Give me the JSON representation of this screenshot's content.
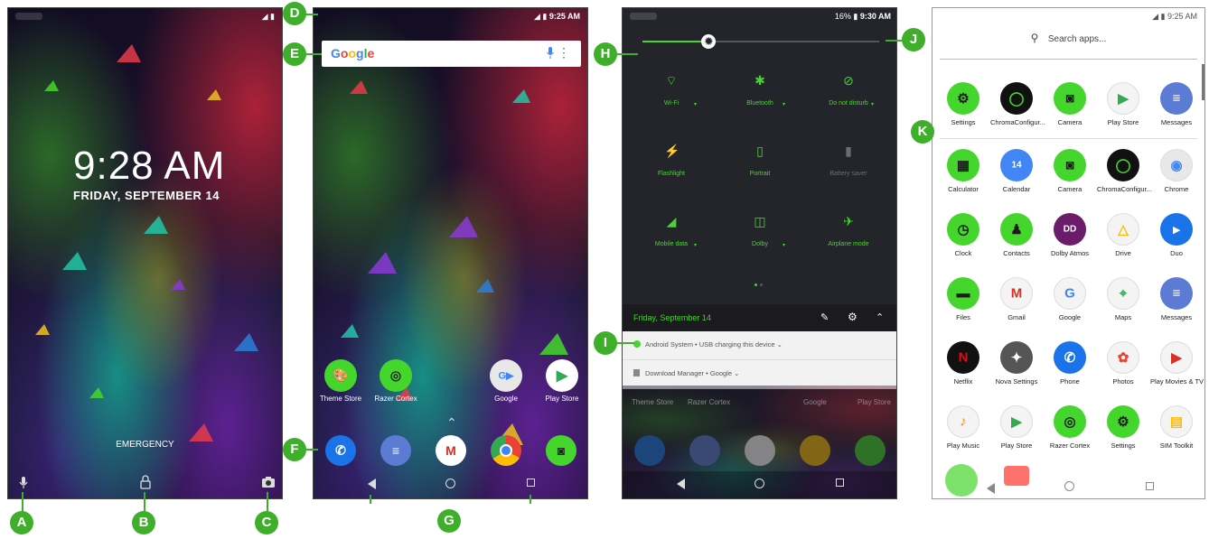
{
  "lock_screen": {
    "time": "9:28 AM",
    "date": "FRIDAY, SEPTEMBER 14",
    "emergency": "EMERGENCY"
  },
  "home_screen": {
    "status_time": "9:25 AM",
    "search_logo": "Google",
    "apps": [
      {
        "label": "Theme Store",
        "color": "#44d62c"
      },
      {
        "label": "Razer Cortex",
        "color": "#44d62c"
      },
      {
        "label": "Google",
        "color": "#e8e8e8"
      },
      {
        "label": "Play Store",
        "color": "#ffffff"
      }
    ],
    "dock": [
      {
        "name": "phone",
        "color": "#1a73e8"
      },
      {
        "name": "messages",
        "color": "#5b7bd5"
      },
      {
        "name": "gmail",
        "color": "#ffffff"
      },
      {
        "name": "chrome",
        "color": "#e8e8e8"
      },
      {
        "name": "camera",
        "color": "#44d62c"
      }
    ]
  },
  "quick_settings": {
    "status_battery": "16%",
    "status_time": "9:30 AM",
    "brightness_level": 0.28,
    "tiles": [
      {
        "label": "Wi-Fi",
        "on": true,
        "dropdown": true
      },
      {
        "label": "Bluetooth",
        "on": true,
        "dropdown": true
      },
      {
        "label": "Do not disturb",
        "on": true,
        "dropdown": true
      },
      {
        "label": "Flashlight",
        "on": true,
        "dropdown": false
      },
      {
        "label": "Portrait",
        "on": true,
        "dropdown": false
      },
      {
        "label": "Battery saver",
        "on": false,
        "dropdown": false
      },
      {
        "label": "Mobile data",
        "on": true,
        "dropdown": true
      },
      {
        "label": "Dolby",
        "on": true,
        "dropdown": true
      },
      {
        "label": "Airplane mode",
        "on": true,
        "dropdown": false
      }
    ],
    "date": "Friday, September 14",
    "notifications": [
      "Android System • USB charging this device ⌄",
      "Download Manager • Google ⌄"
    ],
    "dim_labels": [
      "Theme Store",
      "Razer Cortex",
      "Google",
      "Play Store"
    ]
  },
  "app_drawer": {
    "status_time": "9:25 AM",
    "search_placeholder": "Search apps...",
    "top_row": [
      "Settings",
      "ChromaConfigur...",
      "Camera",
      "Play Store",
      "Messages"
    ],
    "rows": [
      [
        "Calculator",
        "Calendar",
        "Camera",
        "ChromaConfigur...",
        "Chrome"
      ],
      [
        "Clock",
        "Contacts",
        "Dolby Atmos",
        "Drive",
        "Duo"
      ],
      [
        "Files",
        "Gmail",
        "Google",
        "Maps",
        "Messages"
      ],
      [
        "Netflix",
        "Nova Settings",
        "Phone",
        "Photos",
        "Play Movies & TV"
      ],
      [
        "Play Music",
        "Play Store",
        "Razer Cortex",
        "Settings",
        "SIM Toolkit"
      ]
    ],
    "colors": {
      "Settings": "#44d62c",
      "ChromaConfigur...": "#111111",
      "Camera": "#44d62c",
      "Play Store": "#f4f4f4",
      "Messages": "#5b7bd5",
      "Calculator": "#44d62c",
      "Calendar": "#4285f4",
      "Chrome": "#e8e8e8",
      "Clock": "#44d62c",
      "Contacts": "#44d62c",
      "Dolby Atmos": "#6a1b6a",
      "Drive": "#f4f4f4",
      "Duo": "#1a73e8",
      "Files": "#44d62c",
      "Gmail": "#f4f4f4",
      "Google": "#f4f4f4",
      "Maps": "#f4f4f4",
      "Netflix": "#111111",
      "Nova Settings": "#555555",
      "Phone": "#1a73e8",
      "Photos": "#f4f4f4",
      "Play Movies & TV": "#f4f4f4",
      "Play Music": "#f4f4f4",
      "Razer Cortex": "#44d62c",
      "SIM Toolkit": "#f4f4f4"
    }
  },
  "callouts": [
    "A",
    "B",
    "C",
    "D",
    "E",
    "F",
    "G",
    "H",
    "I",
    "J",
    "K"
  ],
  "accent": "#44d62c"
}
